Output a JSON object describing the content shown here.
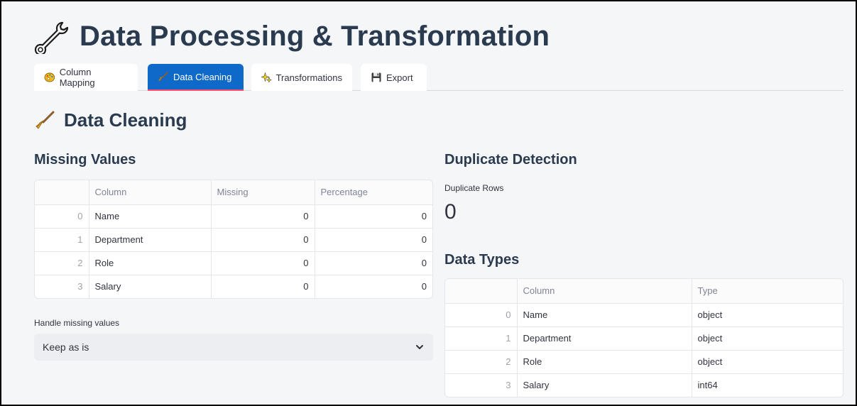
{
  "header": {
    "title": "Data Processing & Transformation"
  },
  "tabs": [
    {
      "label": "Column Mapping",
      "icon": "palette-icon"
    },
    {
      "label": "Data Cleaning",
      "icon": "broom-icon",
      "active": true
    },
    {
      "label": "Transformations",
      "icon": "sparkles-icon"
    },
    {
      "label": "Export",
      "icon": "floppy-disk-icon"
    }
  ],
  "section": {
    "title": "Data Cleaning"
  },
  "missing": {
    "title": "Missing Values",
    "columns": [
      "",
      "Column",
      "Missing",
      "Percentage"
    ],
    "rows": [
      {
        "index": "0",
        "column": "Name",
        "missing": "0",
        "percentage": "0"
      },
      {
        "index": "1",
        "column": "Department",
        "missing": "0",
        "percentage": "0"
      },
      {
        "index": "2",
        "column": "Role",
        "missing": "0",
        "percentage": "0"
      },
      {
        "index": "3",
        "column": "Salary",
        "missing": "0",
        "percentage": "0"
      }
    ],
    "handle_label": "Handle missing values",
    "handle_value": "Keep as is"
  },
  "duplicates": {
    "title": "Duplicate Detection",
    "metric_label": "Duplicate Rows",
    "metric_value": "0"
  },
  "dtypes": {
    "title": "Data Types",
    "columns": [
      "",
      "Column",
      "Type"
    ],
    "rows": [
      {
        "index": "0",
        "column": "Name",
        "type": "object"
      },
      {
        "index": "1",
        "column": "Department",
        "type": "object"
      },
      {
        "index": "2",
        "column": "Role",
        "type": "object"
      },
      {
        "index": "3",
        "column": "Salary",
        "type": "int64"
      }
    ]
  },
  "colors": {
    "active_tab": "#0f69c9",
    "active_tab_underline": "#ff4b6e",
    "heading": "#2a3a4f"
  }
}
